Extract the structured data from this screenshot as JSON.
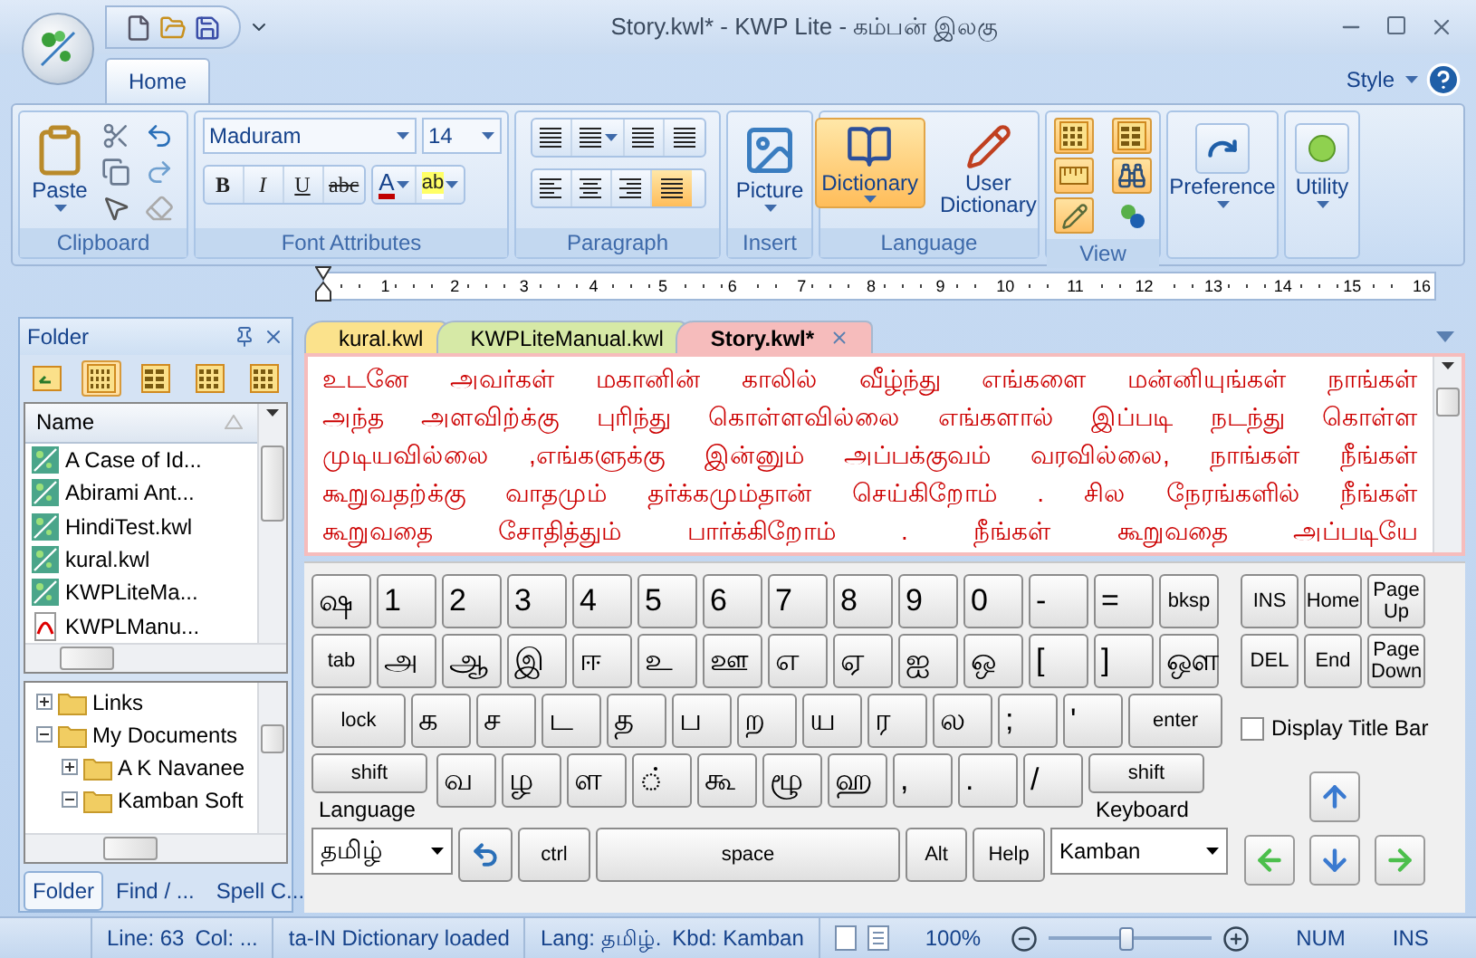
{
  "window": {
    "title": "Story.kwl* - KWP Lite - கம்பன் இலகு"
  },
  "ribbon_tabs": [
    {
      "label": "Home",
      "selected": true
    }
  ],
  "style_menu": {
    "label": "Style"
  },
  "ribbon": {
    "clipboard": {
      "label": "Clipboard",
      "paste": "Paste"
    },
    "font": {
      "label": "Font Attributes",
      "font_name": "Maduram",
      "font_size": "14",
      "styles": [
        {
          "label": "B",
          "kind": "bold"
        },
        {
          "label": "I",
          "kind": "italic"
        },
        {
          "label": "U",
          "kind": "underline"
        },
        {
          "label": "abc",
          "kind": "strike"
        }
      ],
      "font_color": "A",
      "highlight": "ab"
    },
    "paragraph": {
      "label": "Paragraph",
      "alignments": [
        {
          "selected": false
        },
        {
          "selected": false
        },
        {
          "selected": false
        },
        {
          "selected": true
        }
      ]
    },
    "insert": {
      "label": "Insert",
      "picture": "Picture"
    },
    "language": {
      "label": "Language",
      "buttons": [
        {
          "label": "Dictionary",
          "selected": true
        },
        {
          "label": "User Dictionary",
          "selected": false
        }
      ]
    },
    "view": {
      "label": "View",
      "buttons": [
        {
          "selected": true
        },
        {
          "selected": true
        },
        {
          "selected": true
        },
        {
          "selected": true
        },
        {
          "selected": true
        },
        {
          "selected": false
        }
      ]
    },
    "preference": {
      "label": "Preference"
    },
    "utility": {
      "label": "Utility"
    }
  },
  "ruler": {
    "labels": [
      "1",
      "2",
      "3",
      "4",
      "5",
      "6",
      "7",
      "8",
      "9",
      "10",
      "11",
      "12",
      "13",
      "14",
      "15",
      "16"
    ]
  },
  "folder_panel": {
    "title": "Folder",
    "toolbar": [
      {
        "selected": false
      },
      {
        "selected": true
      },
      {
        "selected": false
      },
      {
        "selected": false
      },
      {
        "selected": false
      }
    ],
    "column": "Name",
    "files": [
      {
        "name": "A Case of Id...",
        "kind": "kwl"
      },
      {
        "name": "Abirami Ant...",
        "kind": "kwl"
      },
      {
        "name": "HindiTest.kwl",
        "kind": "kwl"
      },
      {
        "name": "kural.kwl",
        "kind": "kwl"
      },
      {
        "name": "KWPLiteMa...",
        "kind": "kwl"
      },
      {
        "name": "KWPLManu...",
        "kind": "pdf"
      }
    ],
    "tree": [
      {
        "label": "Links",
        "expanded": false
      },
      {
        "label": "My Documents",
        "expanded": true,
        "children": [
          {
            "label": "A K Navanee",
            "expanded": false
          },
          {
            "label": "Kamban Soft",
            "expanded": true
          }
        ]
      }
    ],
    "tabs": [
      {
        "label": "Folder",
        "selected": true
      },
      {
        "label": "Find / ...",
        "selected": false
      },
      {
        "label": "Spell C...",
        "selected": false
      }
    ]
  },
  "doc_tabs": [
    {
      "label": "kural.kwl",
      "color": "#fbe28c",
      "selected": false
    },
    {
      "label": "KWPLiteManual.kwl",
      "color": "#d6e9a6",
      "selected": false
    },
    {
      "label": "Story.kwl*",
      "color": "#f6bcbc",
      "selected": true
    }
  ],
  "editor": {
    "lines": [
      "உடனே அவர்கள் மகானின் காலில் வீழ்ந்து எங்களை மன்னியுங்கள் நாங்கள்",
      "அந்த அளவிற்க்கு புரிந்து கொள்ளவில்லை எங்களால் இப்படி நடந்து கொள்ள",
      "முடியவில்லை ,எங்களுக்கு இன்னும் அப்பக்குவம் வரவில்லை, நாங்கள் நீங்கள்",
      "கூறுவதற்க்கு வாதமும் தர்க்கமும்தான் செய்கிறோம் . சில நேரங்களில் நீங்கள்",
      "கூறுவதை சோதித்தும் பார்க்கிறோம் . நீங்கள் கூறுவதை அப்படியே"
    ]
  },
  "keyboard": {
    "rows": [
      {
        "keys": [
          {
            "label": "ஷ",
            "kind": "char"
          },
          {
            "label": "1",
            "kind": "char"
          },
          {
            "label": "2",
            "kind": "char"
          },
          {
            "label": "3",
            "kind": "char"
          },
          {
            "label": "4",
            "kind": "char"
          },
          {
            "label": "5",
            "kind": "char"
          },
          {
            "label": "6",
            "kind": "char"
          },
          {
            "label": "7",
            "kind": "char"
          },
          {
            "label": "8",
            "kind": "char"
          },
          {
            "label": "9",
            "kind": "char"
          },
          {
            "label": "0",
            "kind": "char"
          },
          {
            "label": "-",
            "kind": "char"
          },
          {
            "label": "=",
            "kind": "char"
          },
          {
            "label": "bksp",
            "kind": "command"
          }
        ]
      },
      {
        "keys": [
          {
            "label": "tab",
            "kind": "command"
          },
          {
            "label": "அ",
            "kind": "char"
          },
          {
            "label": "ஆ",
            "kind": "char"
          },
          {
            "label": "இ",
            "kind": "char"
          },
          {
            "label": "ஈ",
            "kind": "char"
          },
          {
            "label": "உ",
            "kind": "char"
          },
          {
            "label": "ஊ",
            "kind": "char"
          },
          {
            "label": "எ",
            "kind": "char"
          },
          {
            "label": "ஏ",
            "kind": "char"
          },
          {
            "label": "ஐ",
            "kind": "char"
          },
          {
            "label": "ஒ",
            "kind": "char"
          },
          {
            "label": "[",
            "kind": "char"
          },
          {
            "label": "]",
            "kind": "char"
          },
          {
            "label": "ஔ",
            "kind": "char"
          }
        ]
      },
      {
        "keys": [
          {
            "label": "lock",
            "kind": "wide"
          },
          {
            "label": "க",
            "kind": "char"
          },
          {
            "label": "ச",
            "kind": "char"
          },
          {
            "label": "ட",
            "kind": "char"
          },
          {
            "label": "த",
            "kind": "char"
          },
          {
            "label": "ப",
            "kind": "char"
          },
          {
            "label": "ற",
            "kind": "char"
          },
          {
            "label": "ய",
            "kind": "char"
          },
          {
            "label": "ர",
            "kind": "char"
          },
          {
            "label": "ல",
            "kind": "char"
          },
          {
            "label": ";",
            "kind": "char"
          },
          {
            "label": "'",
            "kind": "char"
          },
          {
            "label": "enter",
            "kind": "wide"
          }
        ]
      },
      {
        "keys": [
          {
            "label": "shift",
            "kind": "shift",
            "caption": "Language"
          },
          {
            "label": "வ",
            "kind": "char"
          },
          {
            "label": "ழ",
            "kind": "char"
          },
          {
            "label": "ள",
            "kind": "char"
          },
          {
            "label": "்",
            "kind": "char"
          },
          {
            "label": "கூ",
            "kind": "char"
          },
          {
            "label": "ழூ",
            "kind": "char"
          },
          {
            "label": "ஹ",
            "kind": "char"
          },
          {
            "label": ",",
            "kind": "char"
          },
          {
            "label": ".",
            "kind": "char"
          },
          {
            "label": "/",
            "kind": "char"
          },
          {
            "label": "shift",
            "kind": "shift",
            "caption": "Keyboard"
          }
        ]
      },
      {
        "keys": [
          {
            "label": "தமிழ்",
            "kind": "language_select"
          },
          {
            "kind": "undo"
          },
          {
            "label": "ctrl",
            "kind": "command"
          },
          {
            "label": "space",
            "kind": "space"
          },
          {
            "label": "Alt",
            "kind": "command"
          },
          {
            "label": "Help",
            "kind": "command"
          },
          {
            "label": "Kamban",
            "kind": "layout_select"
          }
        ]
      }
    ],
    "nav_keys": [
      "INS",
      "Home",
      "Page Up",
      "DEL",
      "End",
      "Page Down"
    ],
    "display_title_bar": {
      "label": "Display Title Bar",
      "checked": false
    }
  },
  "status_bar": {
    "line": "Line: 63",
    "col": "Col: ...",
    "dictionary": "ta-IN Dictionary loaded",
    "lang": "Lang: தமிழ்.",
    "kbd": "Kbd: Kamban",
    "zoom": {
      "label": "100%",
      "level": 0.48
    },
    "indicators": [
      "NUM",
      "INS"
    ]
  }
}
